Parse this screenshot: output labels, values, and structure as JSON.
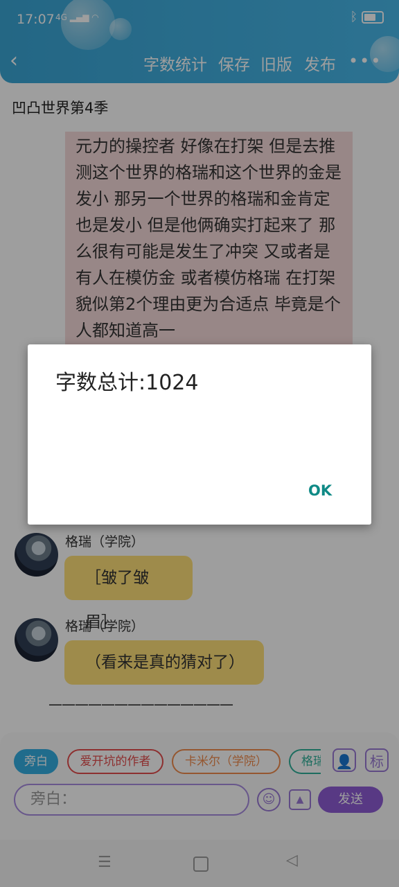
{
  "status_bar": {
    "time": "17:07",
    "signal": "4G",
    "wifi_icon": "wifi-icon",
    "bluetooth_icon": "bluetooth-icon",
    "battery_icon": "battery-icon"
  },
  "header": {
    "back_icon": "chevron-left-icon",
    "actions": {
      "word_count": "字数统计",
      "save": "保存",
      "old_version": "旧版",
      "publish": "发布"
    },
    "more_icon": "more-dots-icon",
    "color": "#3aa6d6"
  },
  "document": {
    "title": "凹凸世界第4季",
    "narration": "元力的操控者 好像在打架 但是去推测这个世界的格瑞和这个世界的金是发小 那另一个世界的格瑞和金肯定也是发小 但是他俩确实打起来了 那么很有可能是发生了冲突 又或者是有人在模仿金 或者模仿格瑞 在打架 貌似第2个理由更为合适点 毕竟是个人都知道高一"
  },
  "messages": [
    {
      "sender": "格瑞（学院）",
      "text": "［皱了皱眉］"
    },
    {
      "sender": "格瑞（学院）",
      "text": "（看来是真的猜对了）"
    }
  ],
  "divider": "——————————————",
  "composer": {
    "roles": [
      {
        "label": "旁白",
        "color": "#34aee3"
      },
      {
        "label": "爱开坑的作者",
        "color": "#e44d4d"
      },
      {
        "label": "卡米尔（学院）",
        "color": "#f08c4c"
      },
      {
        "label": "格瑞",
        "color": "#2fb09a"
      }
    ],
    "role_icon": "person-icon",
    "tag_label": "标",
    "input_placeholder": "旁白：",
    "emoji_icon": "smile-icon",
    "image_icon": "image-icon",
    "send_label": "发送"
  },
  "system_nav": {
    "menu_icon": "menu-icon",
    "home_icon": "home-icon",
    "back_icon": "back-triangle-icon"
  },
  "dialog": {
    "message": "字数总计:1024",
    "ok_label": "OK"
  }
}
